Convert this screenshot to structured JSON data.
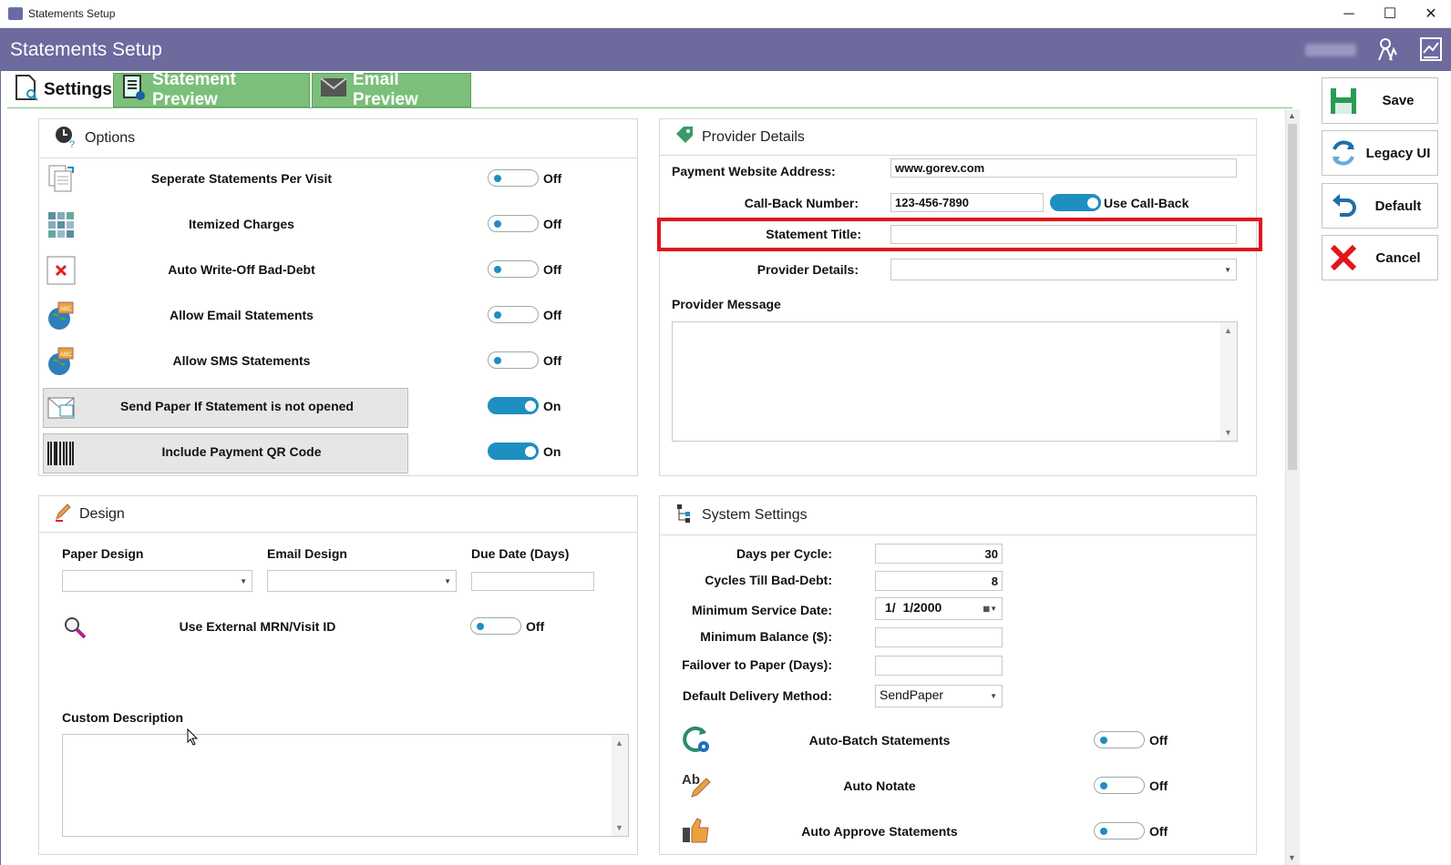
{
  "window": {
    "title": "Statements Setup",
    "minimize": "─",
    "maximize": "☐",
    "close": "✕"
  },
  "header": {
    "title": "Statements Setup"
  },
  "tabs": [
    {
      "label": "Settings"
    },
    {
      "label": "Statement Preview"
    },
    {
      "label": "Email Preview"
    }
  ],
  "options": {
    "title": "Options",
    "items": [
      {
        "label": "Seperate Statements Per Visit",
        "state": "Off",
        "on": false,
        "icon": "documents-icon"
      },
      {
        "label": "Itemized Charges",
        "state": "Off",
        "on": false,
        "icon": "grid-icon"
      },
      {
        "label": "Auto Write-Off Bad-Debt",
        "state": "Off",
        "on": false,
        "icon": "delete-icon"
      },
      {
        "label": "Allow Email Statements",
        "state": "Off",
        "on": false,
        "icon": "globe-icon"
      },
      {
        "label": "Allow SMS Statements",
        "state": "Off",
        "on": false,
        "icon": "globe-icon"
      },
      {
        "label": "Send Paper If Statement is not opened",
        "state": "On",
        "on": true,
        "icon": "mail-paper-icon"
      },
      {
        "label": "Include Payment QR Code",
        "state": "On",
        "on": true,
        "icon": "barcode-icon"
      }
    ]
  },
  "provider": {
    "title": "Provider Details",
    "website_label": "Payment Website Address:",
    "website_value": "www.gorev.com",
    "callback_label": "Call-Back Number:",
    "callback_value": "123-456-7890",
    "use_callback_label": "Use Call-Back",
    "statement_title_label": "Statement Title:",
    "statement_title_value": "",
    "details_label": "Provider Details:",
    "details_value": "",
    "message_label": "Provider Message",
    "message_value": ""
  },
  "design": {
    "title": "Design",
    "paper_label": "Paper Design",
    "email_label": "Email Design",
    "due_label": "Due Date (Days)",
    "paper_value": "",
    "email_value": "",
    "due_value": "",
    "external_label": "Use External MRN/Visit ID",
    "external_state": "Off",
    "custom_label": "Custom Description",
    "custom_value": ""
  },
  "system": {
    "title": "System Settings",
    "days_label": "Days per Cycle:",
    "days_value": "30",
    "cycles_label": "Cycles Till Bad-Debt:",
    "cycles_value": "8",
    "min_date_label": "Minimum Service Date:",
    "min_date_value": "1/  1/2000",
    "min_balance_label": "Minimum Balance ($):",
    "min_balance_value": "",
    "failover_label": "Failover to Paper (Days):",
    "failover_value": "",
    "delivery_label": "Default Delivery Method:",
    "delivery_value": "SendPaper",
    "items": [
      {
        "label": "Auto-Batch Statements",
        "state": "Off"
      },
      {
        "label": "Auto Notate",
        "state": "Off"
      },
      {
        "label": "Auto Approve Statements",
        "state": "Off"
      }
    ]
  },
  "actions": {
    "save": "Save",
    "legacy": "Legacy UI",
    "default": "Default",
    "cancel": "Cancel"
  },
  "colors": {
    "header": "#6d6a9e",
    "tab_green": "#7bbf7b",
    "toggle_blue": "#1d8fc0",
    "highlight_red": "#e2141c"
  }
}
